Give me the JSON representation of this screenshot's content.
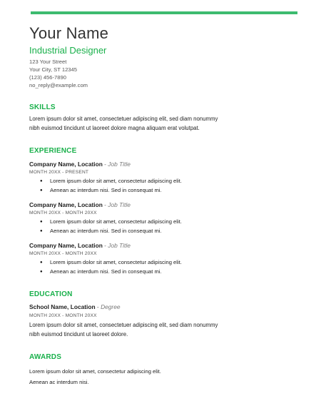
{
  "header": {
    "name": "Your Name",
    "role": "Industrial Designer",
    "contact": [
      "123 Your Street",
      "Your City, ST 12345",
      "(123) 456-7890",
      "no_reply@example.com"
    ]
  },
  "skills": {
    "title": "SKILLS",
    "lines": [
      "Lorem ipsum dolor sit amet, consectetuer adipiscing elit, sed diam nonummy",
      "nibh euismod tincidunt ut laoreet dolore magna aliquam erat volutpat."
    ]
  },
  "experience": {
    "title": "EXPERIENCE",
    "jobs": [
      {
        "company": "Company Name,  Location",
        "dash": " - ",
        "job_title": "Job Title",
        "dates": "MONTH 20XX - PRESENT",
        "bullets": [
          "Lorem ipsum dolor sit amet, consectetur adipiscing elit.",
          "Aenean ac interdum nisi. Sed in consequat mi."
        ]
      },
      {
        "company": "Company Name, Location",
        "dash": " - ",
        "job_title": "Job Title",
        "dates": "MONTH 20XX - MONTH 20XX",
        "bullets": [
          "Lorem ipsum dolor sit amet, consectetur adipiscing elit.",
          "Aenean ac interdum nisi. Sed in consequat mi."
        ]
      },
      {
        "company": "Company Name, Location",
        "dash": " - ",
        "job_title": "Job Title",
        "dates": "MONTH 20XX - MONTH 20XX",
        "bullets": [
          "Lorem ipsum dolor sit amet, consectetur adipiscing elit.",
          "Aenean ac interdum nisi. Sed in consequat mi."
        ]
      }
    ]
  },
  "education": {
    "title": "EDUCATION",
    "school": "School Name, Location",
    "dash": " - ",
    "degree": "Degree",
    "dates": "MONTH 20XX - MONTH 20XX",
    "lines": [
      "Lorem ipsum dolor sit amet, consectetuer adipiscing elit, sed diam nonummy",
      "nibh euismod tincidunt ut laoreet dolore."
    ]
  },
  "awards": {
    "title": "AWARDS",
    "lines": [
      "Lorem ipsum dolor sit amet, consectetur adipiscing elit.",
      "Aenean ac interdum nisi."
    ]
  },
  "colors": {
    "accent": "#18b04a",
    "bar": "#3dbb6f"
  }
}
